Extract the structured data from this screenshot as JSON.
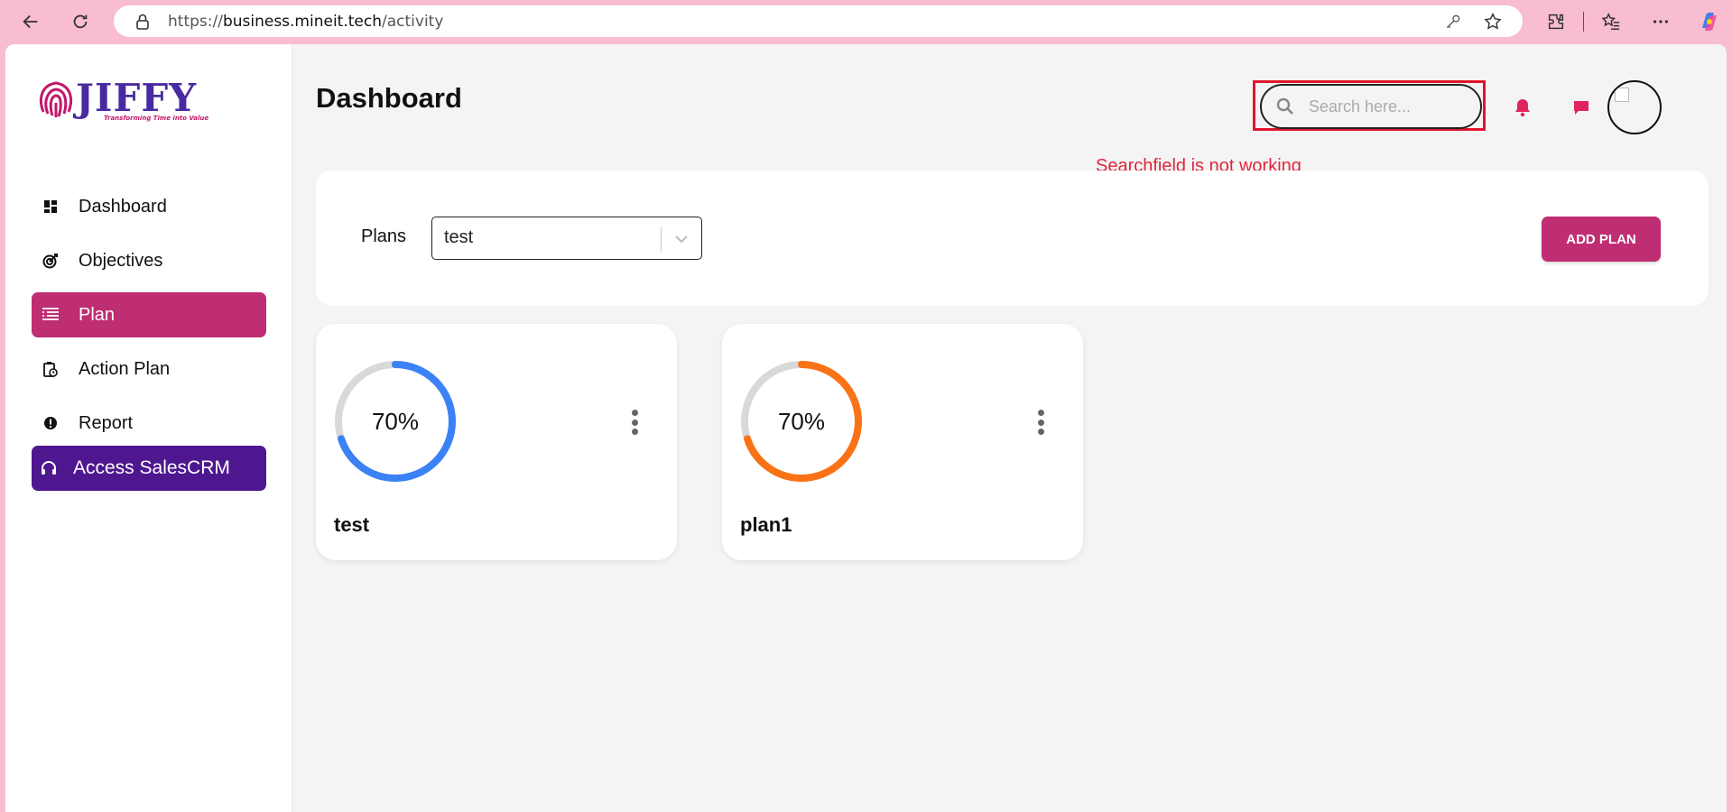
{
  "browser": {
    "url_prefix": "https://",
    "url_host": "business.mineit.tech",
    "url_path": "/activity"
  },
  "sidebar": {
    "brand": "JIFFY",
    "tagline": "Transforming Time into Value",
    "items": [
      {
        "label": "Dashboard",
        "icon": "dashboard-icon"
      },
      {
        "label": "Objectives",
        "icon": "target-icon"
      },
      {
        "label": "Plan",
        "icon": "list-icon",
        "active": true
      },
      {
        "label": "Action Plan",
        "icon": "clipboard-clock-icon"
      },
      {
        "label": "Report",
        "icon": "alert-circle-icon"
      }
    ],
    "crm_label": "Access SalesCRM"
  },
  "header": {
    "title": "Dashboard",
    "search_placeholder": "Search here...",
    "annotation": "Searchfield is not working"
  },
  "plans_panel": {
    "label": "Plans",
    "selected": "test",
    "add_button": "ADD PLAN"
  },
  "cards": [
    {
      "name": "test",
      "percent_label": "70%",
      "progress": 0.7,
      "color": "#3b82f6"
    },
    {
      "name": "plan1",
      "percent_label": "70%",
      "progress": 0.7,
      "color": "#f97316"
    }
  ],
  "colors": {
    "accent": "#bf2d72",
    "crm": "#4f178f",
    "annotation": "#e0162c",
    "ring_track": "#d9d9d9"
  }
}
